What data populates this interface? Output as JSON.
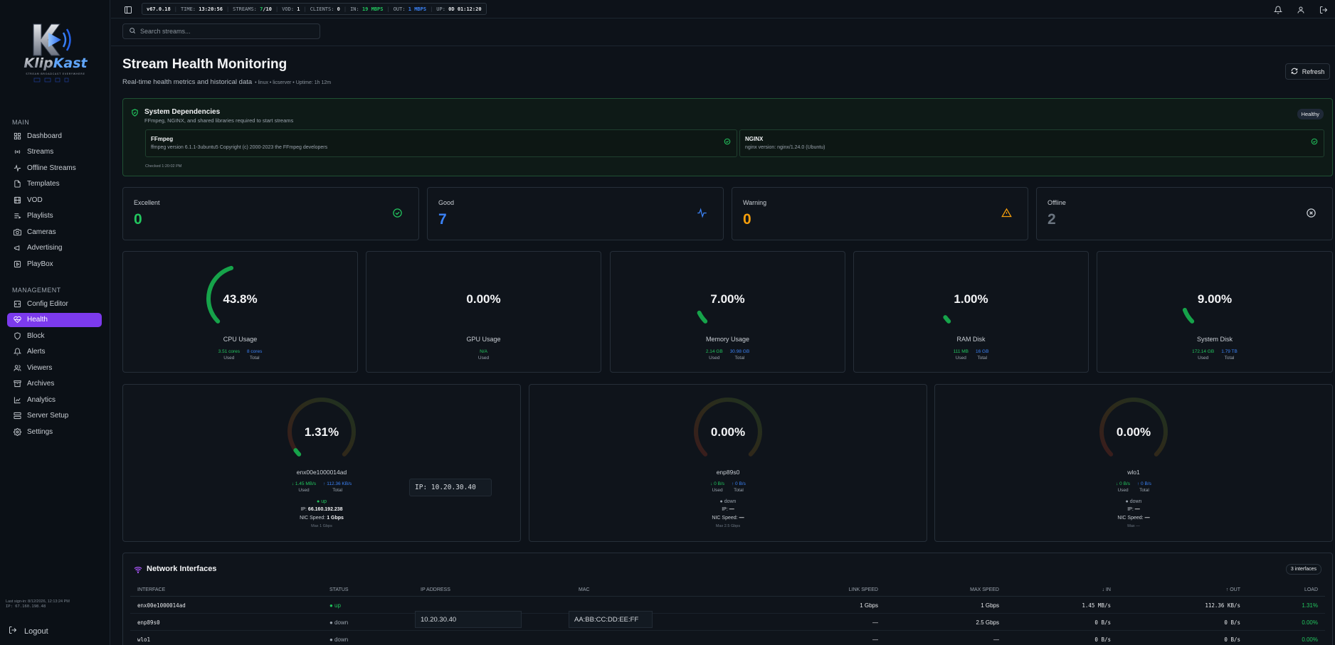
{
  "app": {
    "name": "KlipKast",
    "tagline": "STREAM BROADCAST EVERYWHERE"
  },
  "sidebar": {
    "main_label": "MAIN",
    "main_items": [
      {
        "label": "Dashboard",
        "icon": "dashboard-icon"
      },
      {
        "label": "Streams",
        "icon": "radio-icon"
      },
      {
        "label": "Offline Streams",
        "icon": "activity-icon"
      },
      {
        "label": "Templates",
        "icon": "file-icon"
      },
      {
        "label": "VOD",
        "icon": "film-icon"
      },
      {
        "label": "Playlists",
        "icon": "playlist-icon"
      },
      {
        "label": "Cameras",
        "icon": "camera-icon"
      },
      {
        "label": "Advertising",
        "icon": "megaphone-icon"
      },
      {
        "label": "PlayBox",
        "icon": "play-icon"
      }
    ],
    "management_label": "MANAGEMENT",
    "management_items": [
      {
        "label": "Config Editor",
        "icon": "code-icon"
      },
      {
        "label": "Health",
        "icon": "heart-pulse-icon",
        "active": true
      },
      {
        "label": "Block",
        "icon": "shield-icon"
      },
      {
        "label": "Alerts",
        "icon": "bell-icon"
      },
      {
        "label": "Viewers",
        "icon": "users-icon"
      },
      {
        "label": "Archives",
        "icon": "archive-icon"
      },
      {
        "label": "Analytics",
        "icon": "chart-icon"
      },
      {
        "label": "Server Setup",
        "icon": "server-icon"
      },
      {
        "label": "Settings",
        "icon": "gear-icon"
      }
    ],
    "last_signin": "Last sign-in: 8/12/2026, 12:13:24 PM",
    "last_ip": "IP: 67.160.198.48",
    "logout_label": "Logout"
  },
  "topbar": {
    "version": "v67.0.18",
    "time_label": "TIME:",
    "time_value": "13:20:56",
    "streams_label": "STREAMS:",
    "streams_active": "7",
    "streams_total": "/10",
    "vod_label": "VOD:",
    "vod_value": "1",
    "clients_label": "CLIENTS:",
    "clients_value": "0",
    "in_label": "IN:",
    "in_value": "19 MBPS",
    "out_label": "OUT:",
    "out_value": "1 MBPS",
    "up_label": "UP:",
    "up_value": "0D 01:12:20"
  },
  "search": {
    "placeholder": "Search streams..."
  },
  "page": {
    "title": "Stream Health Monitoring",
    "subtitle": "Real-time health metrics and historical data",
    "meta": "• linux • licserver • Uptime: 1h 12m",
    "refresh_label": "Refresh"
  },
  "dependencies": {
    "title": "System Dependencies",
    "subtitle": "FFmpeg, NGINX, and shared libraries required to start streams",
    "status": "Healthy",
    "items": [
      {
        "name": "FFmpeg",
        "version": "ffmpeg version 6.1.1-3ubuntu5 Copyright (c) 2000-2023 the FFmpeg developers"
      },
      {
        "name": "NGINX",
        "version": "nginx version: nginx/1.24.0 (Ubuntu)"
      }
    ],
    "checked": "Checked 1:20:02 PM"
  },
  "stream_status": [
    {
      "label": "Excellent",
      "value": "0",
      "color": "#22c55e",
      "icon": "check-circle-icon"
    },
    {
      "label": "Good",
      "value": "7",
      "color": "#3b82f6",
      "icon": "activity-icon"
    },
    {
      "label": "Warning",
      "value": "0",
      "color": "#f59e0b",
      "icon": "alert-triangle-icon"
    },
    {
      "label": "Offline",
      "value": "2",
      "color": "#6b7580",
      "icon": "x-circle-icon"
    }
  ],
  "gauges": [
    {
      "label": "CPU Usage",
      "value": "43.8%",
      "fraction": 0.438,
      "used": "3.51 cores",
      "used_label": "Used",
      "total": "8 cores",
      "total_label": "Total"
    },
    {
      "label": "GPU Usage",
      "value": "0.00%",
      "fraction": 0.0,
      "used": "N/A",
      "used_label": "Used"
    },
    {
      "label": "Memory Usage",
      "value": "7.00%",
      "fraction": 0.07,
      "used": "2.14 GB",
      "used_label": "Used",
      "total": "30.98 GB",
      "total_label": "Total"
    },
    {
      "label": "RAM Disk",
      "value": "1.00%",
      "fraction": 0.01,
      "used": "111 MB",
      "used_label": "Used",
      "total": "16 GB",
      "total_label": "Total"
    },
    {
      "label": "System Disk",
      "value": "9.00%",
      "fraction": 0.09,
      "used": "172.14 GB",
      "used_label": "Used",
      "total": "1.79 TB",
      "total_label": "Total"
    }
  ],
  "nics": [
    {
      "name": "enx00e1000014ad",
      "value": "1.31%",
      "fraction": 0.0131,
      "in": "↓ 1.45 MB/s",
      "in_label": "Used",
      "out": "↑ 112.36 KB/s",
      "out_label": "Total",
      "state": "● up",
      "state_color": "#22c55e",
      "ip_label": "IP:",
      "ip": "66.160.192.238",
      "speed_label": "NIC Speed:",
      "speed": "1 Gbps",
      "max": "Max 1 Gbps"
    },
    {
      "name": "enp89s0",
      "value": "0.00%",
      "fraction": 0.0,
      "in": "↓ 0 B/s",
      "in_label": "Used",
      "out": "↑ 0 B/s",
      "out_label": "Total",
      "state": "● down",
      "state_color": "#9aa3ad",
      "ip_label": "IP:",
      "ip": "—",
      "speed_label": "NIC Speed:",
      "speed": "—",
      "max": "Max 2.5 Gbps"
    },
    {
      "name": "wlo1",
      "value": "0.00%",
      "fraction": 0.0,
      "in": "↓ 0 B/s",
      "in_label": "Used",
      "out": "↑ 0 B/s",
      "out_label": "Total",
      "state": "● down",
      "state_color": "#9aa3ad",
      "ip_label": "IP:",
      "ip": "—",
      "speed_label": "NIC Speed:",
      "speed": "—",
      "max": "Max —"
    }
  ],
  "ip_tooltip": "IP: 10.20.30.40",
  "network_table": {
    "title": "Network Interfaces",
    "badge": "3 interfaces",
    "columns": [
      "INTERFACE",
      "STATUS",
      "IP ADDRESS",
      "MAC",
      "LINK SPEED",
      "MAX SPEED",
      "↓ IN",
      "↑ OUT",
      "LOAD"
    ],
    "rows": [
      {
        "interface": "enx00e1000014ad",
        "status": "● up",
        "status_color": "#22c55e",
        "ip": "",
        "mac": "",
        "link": "1 Gbps",
        "max": "1 Gbps",
        "in": "1.45 MB/s",
        "out": "112.36 KB/s",
        "load": "1.31%"
      },
      {
        "interface": "enp89s0",
        "status": "● down",
        "status_color": "#9aa3ad",
        "ip": "",
        "mac": "",
        "link": "—",
        "max": "2.5 Gbps",
        "in": "0 B/s",
        "out": "0 B/s",
        "load": "0.00%"
      },
      {
        "interface": "wlo1",
        "status": "● down",
        "status_color": "#9aa3ad",
        "ip": "",
        "mac": "",
        "link": "—",
        "max": "—",
        "in": "0 B/s",
        "out": "0 B/s",
        "load": "0.00%"
      }
    ],
    "ip_overlay": "10.20.30.40",
    "mac_overlay": "AA:BB:CC:DD:EE:FF"
  },
  "colors": {
    "accent": "#7c3aed",
    "green": "#22c55e",
    "blue": "#3b82f6",
    "amber": "#f59e0b"
  }
}
